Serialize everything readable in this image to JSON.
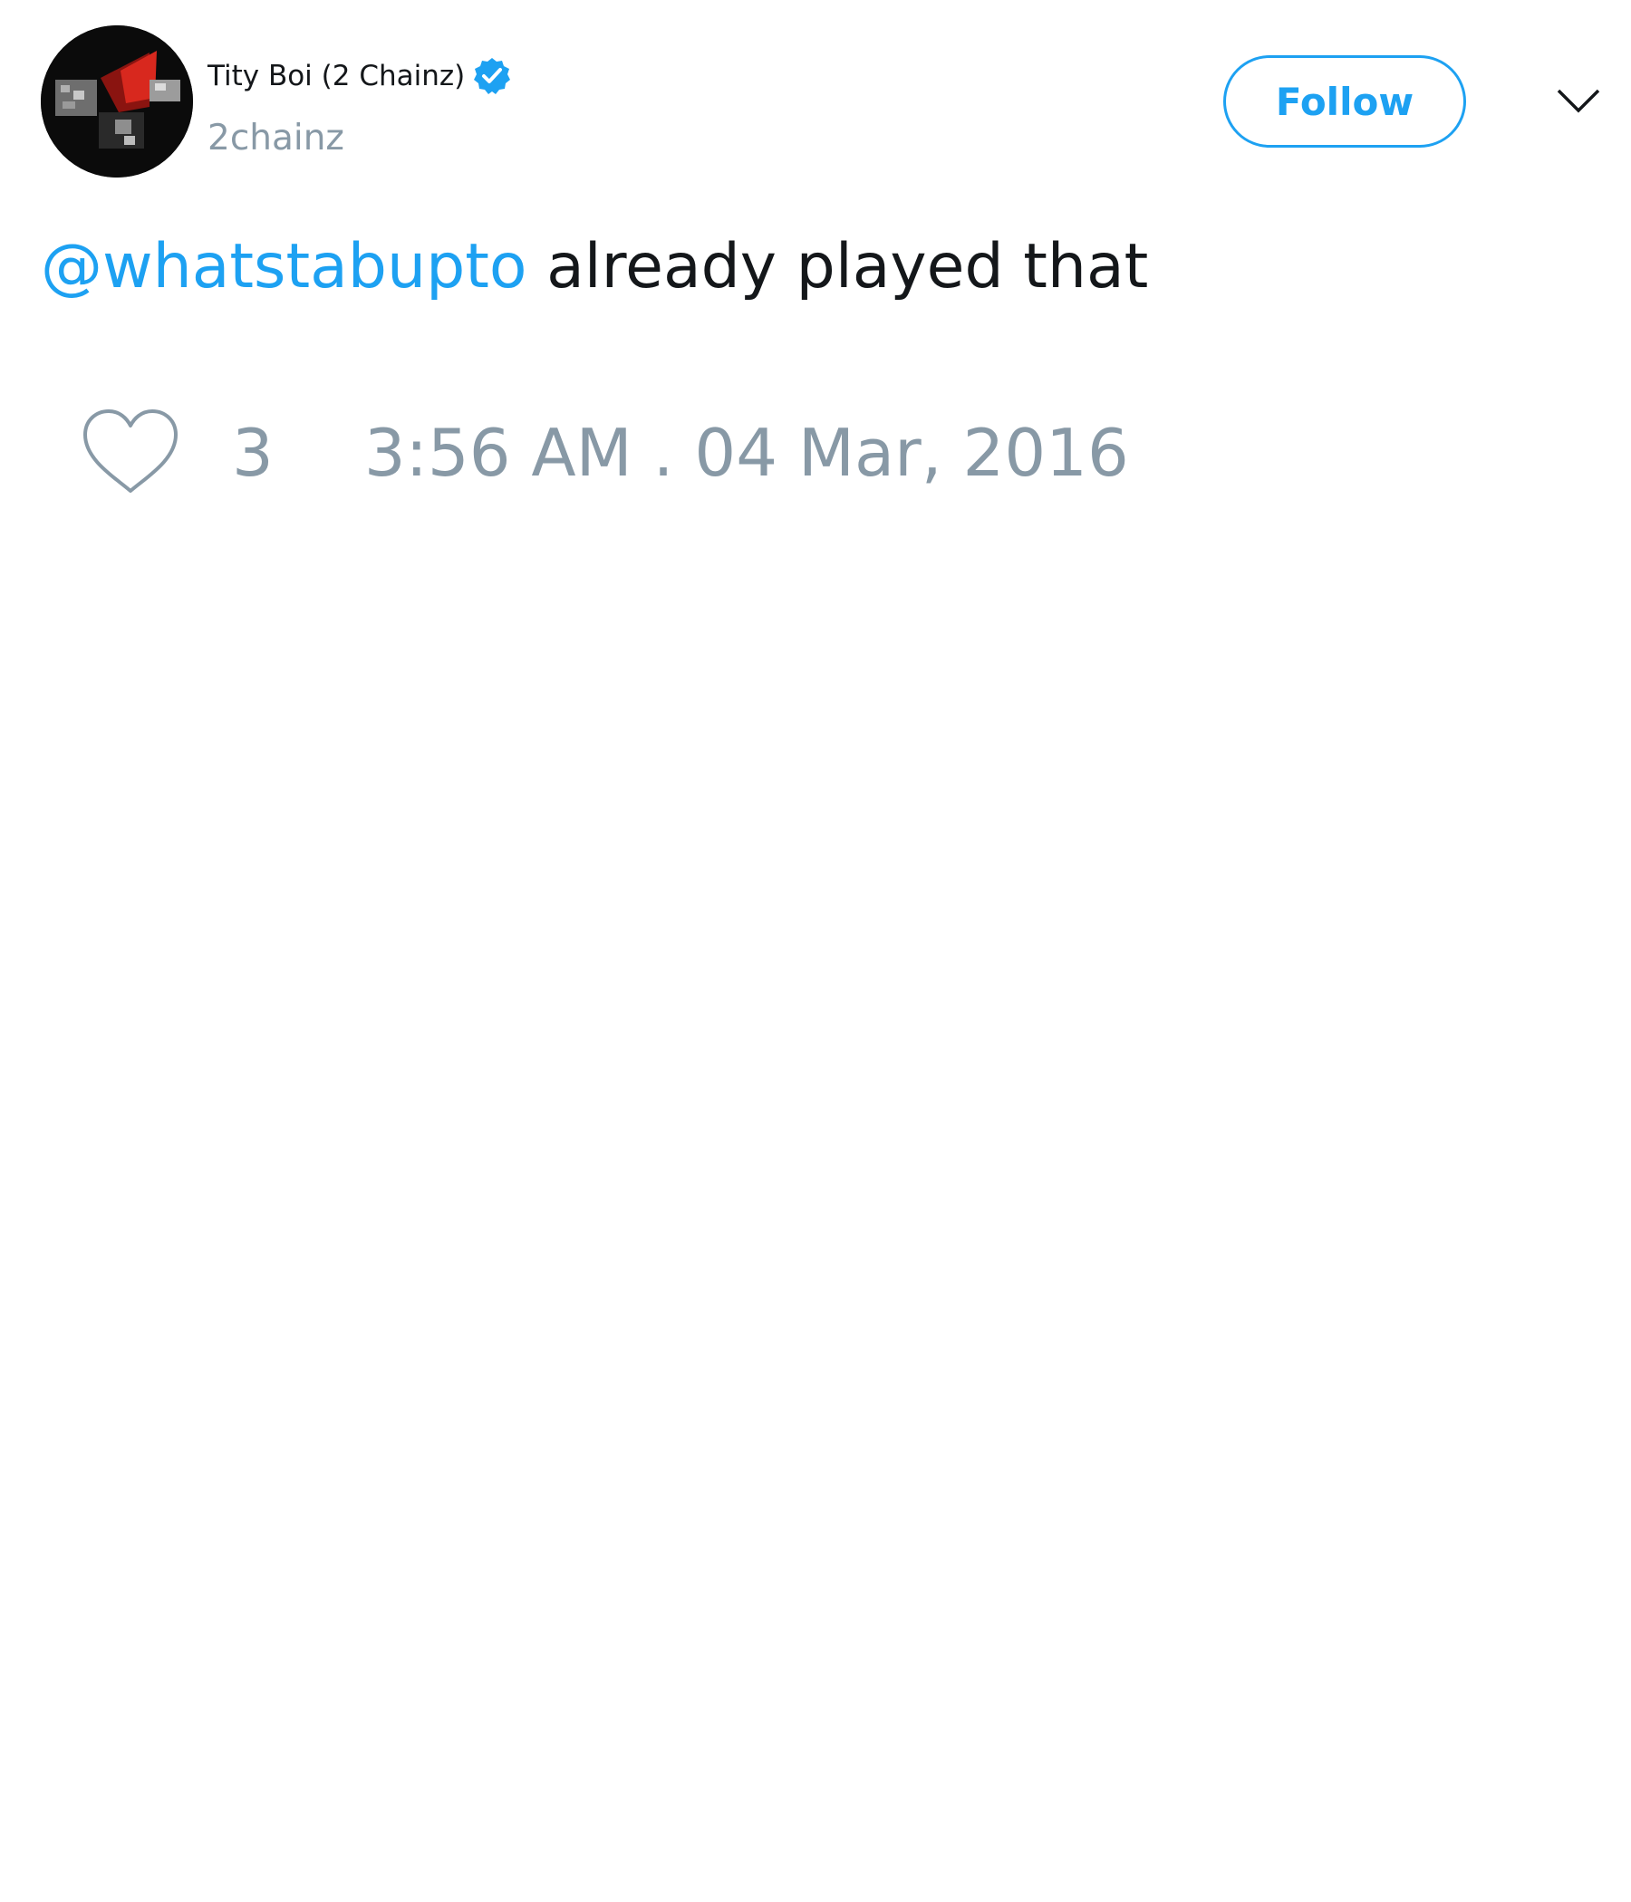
{
  "author": {
    "display_name": "Tity Boi (2 Chainz)",
    "handle": "2chainz",
    "verified": true
  },
  "header": {
    "follow_label": "Follow"
  },
  "tweet": {
    "mention": "@whatstabupto",
    "text": " already played that"
  },
  "footer": {
    "like_count": "3",
    "timestamp": "3:56 AM . 04 Mar, 2016"
  },
  "icons": {
    "verified": "verified-badge-icon",
    "menu": "chevron-down-icon",
    "like": "heart-outline-icon",
    "avatar": "profile-photo"
  },
  "colors": {
    "accent": "#1da1f2",
    "text": "#14171a",
    "secondary": "#8899a6",
    "background": "#ffffff"
  }
}
